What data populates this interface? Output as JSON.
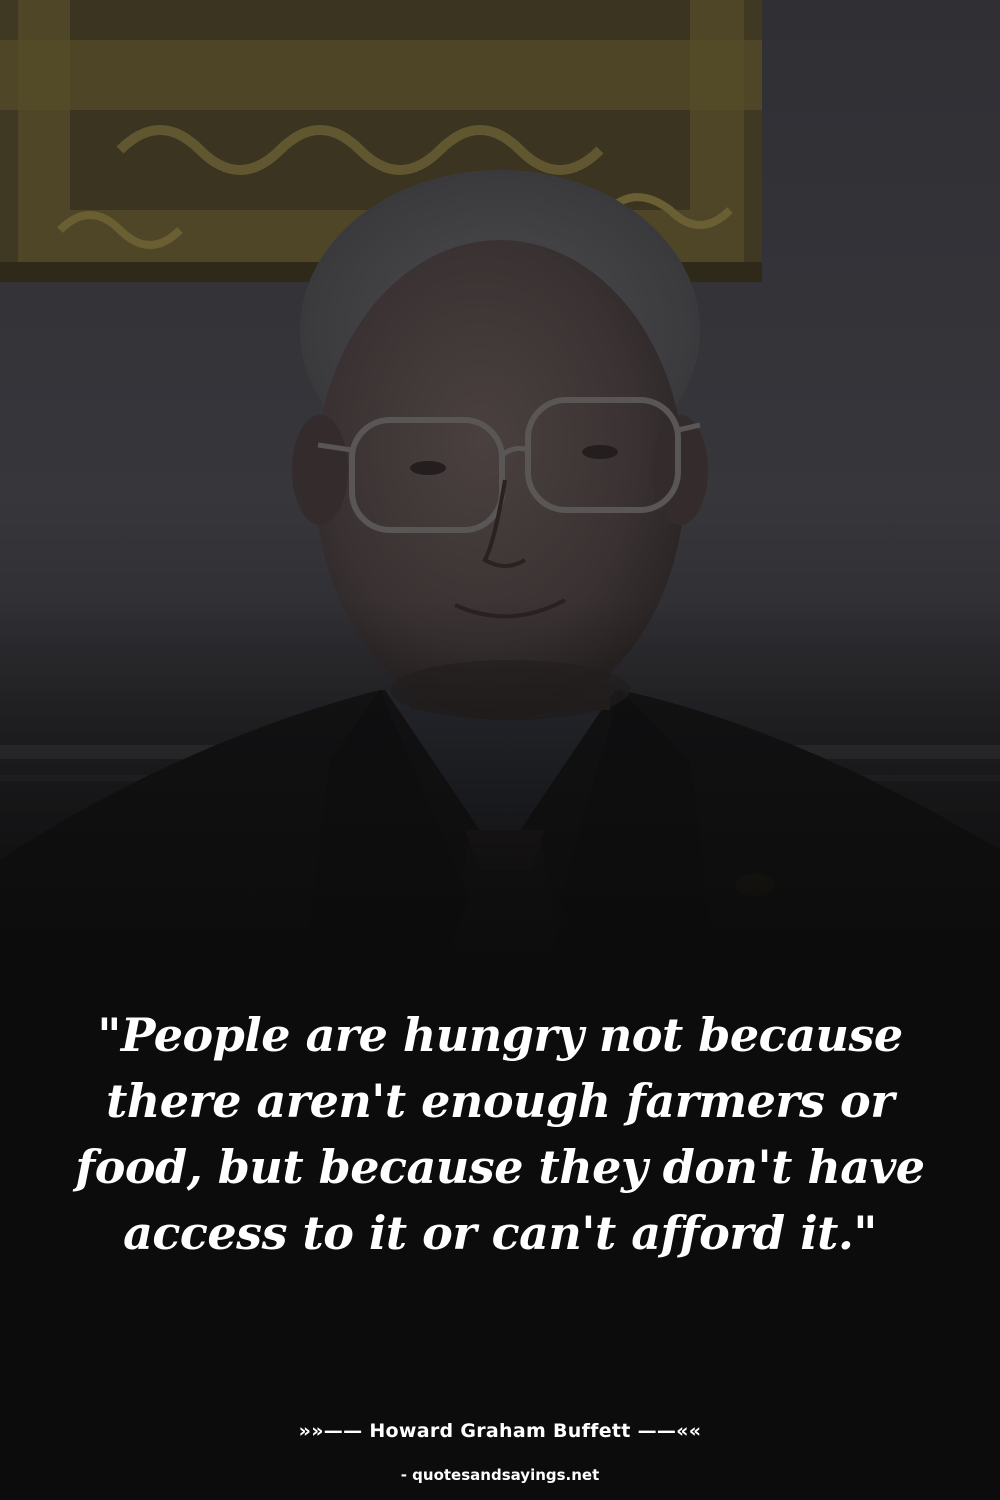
{
  "quote": {
    "text": "\"People are hungry not because there aren't enough farmers or food, but because they don't have access to it or can't afford it.\""
  },
  "author": {
    "line": "»»—— Howard Graham Buffett ——««"
  },
  "source": {
    "text": "- quotesandsayings.net"
  },
  "colors": {
    "background": "#0c0c0c",
    "text": "#ffffff",
    "frame_gold": "#4e4626"
  }
}
